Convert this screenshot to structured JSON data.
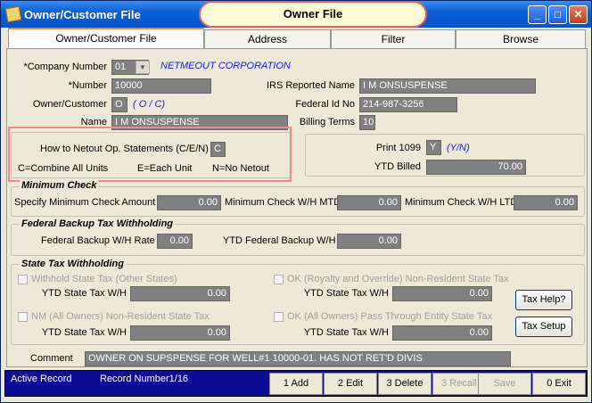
{
  "window": {
    "title": "Owner/Customer File",
    "banner": "Owner File",
    "minimize_label": "_",
    "maximize_label": "□",
    "close_label": "✕"
  },
  "tabs": [
    "Owner/Customer File",
    "Address",
    "Filter",
    "Browse"
  ],
  "owner": {
    "company_number_label": "*Company Number",
    "company_number": "01",
    "company_name": "NETMEOUT CORPORATION",
    "number_label": "*Number",
    "number": "10000",
    "owner_customer_label": "Owner/Customer",
    "owner_customer": "O",
    "owner_customer_hint": "( O / C)",
    "name_label": "Name",
    "name": "I M ONSUSPENSE",
    "irs_name_label": "IRS Reported Name",
    "irs_name": "I M ONSUSPENSE",
    "federal_id_label": "Federal Id No",
    "federal_id": "214-987-3256",
    "billing_terms_label": "Billing Terms",
    "billing_terms": "10"
  },
  "netout": {
    "label": "How to Netout Op. Statements (C/E/N)",
    "value": "C",
    "legend_c": "C=Combine All Units",
    "legend_e": "E=Each Unit",
    "legend_n": "N=No Netout"
  },
  "print1099": {
    "label": "Print 1099",
    "value": "Y",
    "hint": "(Y/N)",
    "ytd_billed_label": "YTD Billed",
    "ytd_billed": "70.00"
  },
  "minimum_check": {
    "title": "Minimum Check",
    "specify_label": "Specify Minimum Check Amount",
    "specify_value": "0.00",
    "mtd_label": "Minimum Check W/H MTD",
    "mtd_value": "0.00",
    "ltd_label": "Minimum Check W/H LTD",
    "ltd_value": "0.00"
  },
  "backup": {
    "title": "Federal Backup Tax Withholding",
    "rate_label": "Federal Backup W/H Rate",
    "rate_value": "0.00",
    "ytd_label": "YTD Federal Backup W/H",
    "ytd_value": "0.00"
  },
  "state_tax": {
    "title": "State Tax Withholding",
    "withhold_other_label": "Withhold State Tax (Other States)",
    "ok_royalty_label": "OK (Royalty and Override) Non-Resident State Tax",
    "nm_label": "NM (All Owners) Non-Resident State Tax",
    "ok_pass_label": "OK (All Owners) Pass Through Entity State Tax",
    "ytd_label": "YTD State Tax W/H",
    "ytd1": "0.00",
    "ytd2": "0.00",
    "ytd3": "0.00",
    "ytd4": "0.00",
    "tax_help": "Tax Help?",
    "tax_setup": "Tax Setup"
  },
  "comment": {
    "label": "Comment",
    "value": "OWNER ON SUPSPENSE FOR WELL#1  10000-01. HAS NOT RET'D DIVIS"
  },
  "status": {
    "active": "Active Record",
    "record_number": "Record Number1/16",
    "add": "1 Add",
    "edit": "2 Edit",
    "delete": "3 Delete",
    "recall": "3 Recall",
    "save": "Save",
    "exit": "0 Exit"
  }
}
